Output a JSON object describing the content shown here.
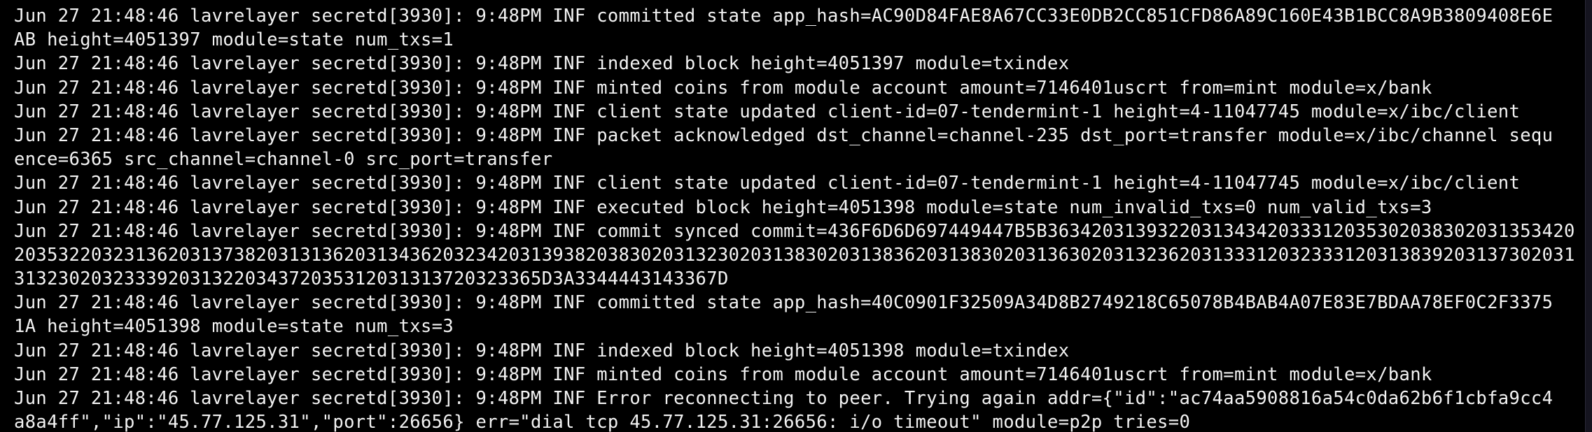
{
  "terminal": {
    "lines": [
      "Jun 27 21:48:46 lavrelayer secretd[3930]: 9:48PM INF committed state app_hash=AC90D84FAE8A67CC33E0DB2CC851CFD86A89C160E43B1BCC8A9B3809408E6E",
      "AB height=4051397 module=state num_txs=1",
      "Jun 27 21:48:46 lavrelayer secretd[3930]: 9:48PM INF indexed block height=4051397 module=txindex",
      "Jun 27 21:48:46 lavrelayer secretd[3930]: 9:48PM INF minted coins from module account amount=7146401uscrt from=mint module=x/bank",
      "Jun 27 21:48:46 lavrelayer secretd[3930]: 9:48PM INF client state updated client-id=07-tendermint-1 height=4-11047745 module=x/ibc/client",
      "Jun 27 21:48:46 lavrelayer secretd[3930]: 9:48PM INF packet acknowledged dst_channel=channel-235 dst_port=transfer module=x/ibc/channel sequ",
      "ence=6365 src_channel=channel-0 src_port=transfer",
      "Jun 27 21:48:46 lavrelayer secretd[3930]: 9:48PM INF client state updated client-id=07-tendermint-1 height=4-11047745 module=x/ibc/client",
      "Jun 27 21:48:46 lavrelayer secretd[3930]: 9:48PM INF executed block height=4051398 module=state num_invalid_txs=0 num_valid_txs=3",
      "Jun 27 21:48:46 lavrelayer secretd[3930]: 9:48PM INF commit synced commit=436F6D6D697449447B5B363420313932203134342033312035302038302031353420",
      "2035322032313620313738203131362031343620323420313938203830203132302031383020313836203138302031363020313236203133312032333120313839203137302031",
      "313230203233392031322034372035312031313720323365D3A3344443143367D",
      "Jun 27 21:48:46 lavrelayer secretd[3930]: 9:48PM INF committed state app_hash=40C0901F32509A34D8B2749218C65078B4BAB4A07E83E7BDAA78EF0C2F3375",
      "1A height=4051398 module=state num_txs=3",
      "Jun 27 21:48:46 lavrelayer secretd[3930]: 9:48PM INF indexed block height=4051398 module=txindex",
      "Jun 27 21:48:46 lavrelayer secretd[3930]: 9:48PM INF minted coins from module account amount=7146401uscrt from=mint module=x/bank",
      "Jun 27 21:48:46 lavrelayer secretd[3930]: 9:48PM INF Error reconnecting to peer. Trying again addr={\"id\":\"ac74aa5908816a54c0da62b6f1cbfa9cc4",
      "a8a4ff\",\"ip\":\"45.77.125.31\",\"port\":26656} err=\"dial tcp 45.77.125.31:26656: i/o timeout\" module=p2p tries=0"
    ]
  },
  "colors": {
    "background": "#000000",
    "foreground": "#f2f2f2"
  }
}
